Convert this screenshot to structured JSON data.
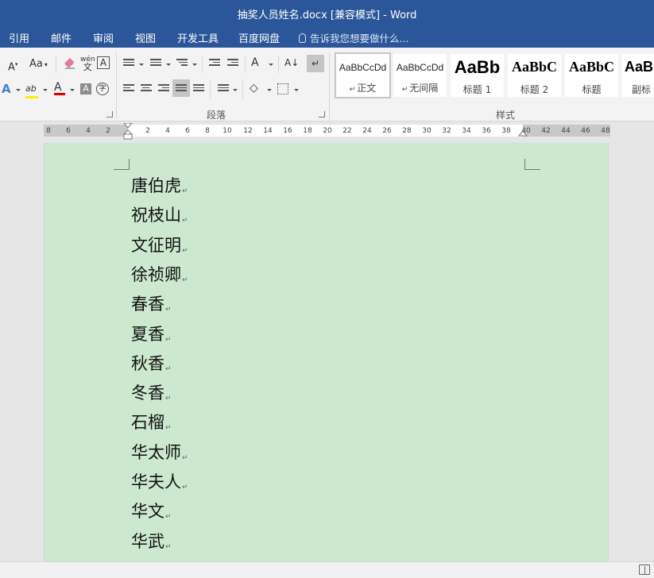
{
  "window": {
    "title": "抽奖人员姓名.docx [兼容模式] - Word"
  },
  "tabs": [
    {
      "label": "引用"
    },
    {
      "label": "邮件"
    },
    {
      "label": "审阅"
    },
    {
      "label": "视图"
    },
    {
      "label": "开发工具"
    },
    {
      "label": "百度网盘"
    }
  ],
  "tell_me": {
    "placeholder": "告诉我您想要做什么..."
  },
  "ribbon": {
    "font_group": {
      "shrink_font": "A",
      "change_case": "Aa",
      "phonetic_guide": "wén\n文",
      "enclose_char": "A",
      "text_effects": "A",
      "highlight": "ab",
      "font_color": "A",
      "char_shading": "A",
      "enclose_char2": "字"
    },
    "paragraph_group": {
      "label": "段落",
      "asian_layout": "A"
    },
    "styles_group": {
      "label": "样式",
      "styles": [
        {
          "sample": "AaBbCcDd",
          "name": "正文",
          "mark": "↵"
        },
        {
          "sample": "AaBbCcDd",
          "name": "无间隔",
          "mark": "↵"
        },
        {
          "sample": "AaBb",
          "name": "标题 1",
          "mark": ""
        },
        {
          "sample": "AaBbC",
          "name": "标题 2",
          "mark": ""
        },
        {
          "sample": "AaBbC",
          "name": "标题",
          "mark": ""
        },
        {
          "sample": "AaBl",
          "name": "副标",
          "mark": ""
        }
      ]
    }
  },
  "ruler": {
    "ticks": [
      "8",
      "6",
      "4",
      "2",
      "2",
      "4",
      "6",
      "8",
      "10",
      "12",
      "14",
      "16",
      "18",
      "20",
      "22",
      "24",
      "26",
      "28",
      "30",
      "32",
      "34",
      "36",
      "38",
      "40",
      "42",
      "44",
      "46",
      "48"
    ]
  },
  "document": {
    "paragraph_mark": "↵",
    "lines": [
      "唐伯虎",
      "祝枝山",
      "文征明",
      "徐祯卿",
      "春香",
      "夏香",
      "秋香",
      "冬香",
      "石榴",
      "华太师",
      "华夫人",
      "华文",
      "华武"
    ]
  },
  "colors": {
    "titlebar": "#2b579a",
    "page_background": "#cce8cf",
    "ribbon": "#f3f3f3"
  }
}
